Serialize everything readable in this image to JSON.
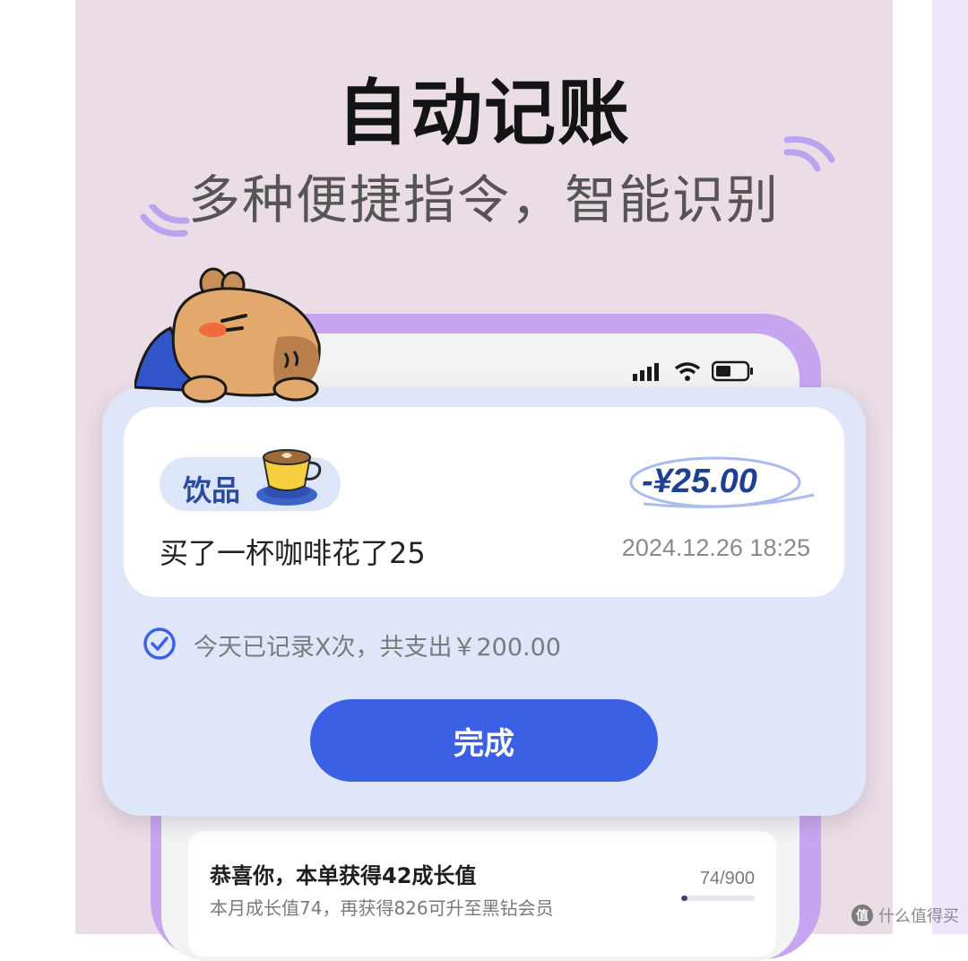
{
  "hero": {
    "title": "自动记账",
    "subtitle": "多种便捷指令，智能识别"
  },
  "status_bar": {
    "icons": [
      "signal-icon",
      "wifi-icon",
      "battery-icon"
    ]
  },
  "record": {
    "category": "饮品",
    "category_icon": "coffee-cup-icon",
    "amount": "-¥25.00",
    "description": "买了一杯咖啡花了25",
    "datetime": "2024.12.26 18:25"
  },
  "summary": {
    "text": "今天已记录X次，共支出￥200.00",
    "icon": "check-circle-icon"
  },
  "done_button": {
    "label": "完成"
  },
  "growth": {
    "title": "恭喜你，本单获得42成长值",
    "subtitle": "本月成长值74，再获得826可升至黑钻会员",
    "progress_text": "74/900",
    "progress_fraction": 0.082
  },
  "watermark": {
    "badge": "值",
    "text": "什么值得买"
  },
  "colors": {
    "background": "#ebdde6",
    "accent": "#3c60e3",
    "phone_border": "#c8a6ef",
    "card": "#dfe6f9"
  }
}
